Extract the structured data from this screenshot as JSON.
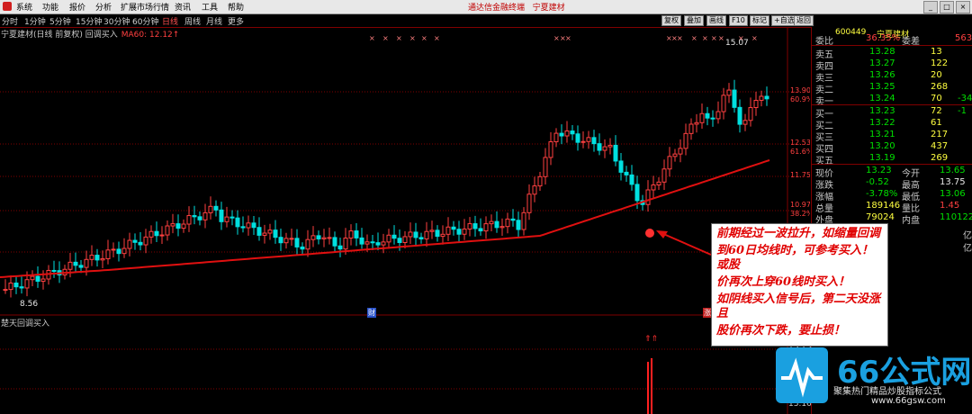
{
  "menu": {
    "items": [
      "系统",
      "功能",
      "报价",
      "分析",
      "扩展市场行情",
      "资讯",
      "工具",
      "帮助"
    ],
    "title": "通达信金融终端",
    "stock_label": "宁夏建材"
  },
  "toolbar": {
    "periods": [
      "分时",
      "1分钟",
      "5分钟",
      "15分钟",
      "30分钟",
      "60分钟",
      "日线",
      "周线",
      "月线",
      "更多"
    ],
    "active_period": "日线",
    "buttons": [
      "复权",
      "叠加",
      "画线",
      "F10",
      "标记",
      "+自选",
      "返回"
    ]
  },
  "chart": {
    "title": "宁夏建材(日线 前复权) 回调买入",
    "ma_label": "MA60: 12.12↑",
    "high_label": "15.07",
    "low_label": "8.56",
    "indicator_title": "楚天回调买入",
    "tag_cai": "财",
    "tag_zhang": "涨",
    "price_axis": [
      "13.90",
      "60.9%",
      "12.53",
      "61.6%",
      "11.75",
      "10.97",
      "38.2%"
    ],
    "lower_axis": [
      "13.75",
      "13.16"
    ]
  },
  "quote": {
    "code": "600449",
    "name": "宁夏建材",
    "weibi_label": "委比",
    "weibi": "36.35%",
    "weicha_label": "委差",
    "weicha": "563",
    "sell": [
      {
        "label": "卖五",
        "price": "13.28",
        "vol": "13"
      },
      {
        "label": "卖四",
        "price": "13.27",
        "vol": "122"
      },
      {
        "label": "卖三",
        "price": "13.26",
        "vol": "20"
      },
      {
        "label": "卖二",
        "price": "13.25",
        "vol": "268"
      },
      {
        "label": "卖一",
        "price": "13.24",
        "vol": "70",
        "chg": "-34"
      }
    ],
    "buy": [
      {
        "label": "买一",
        "price": "13.23",
        "vol": "72",
        "chg": "-1"
      },
      {
        "label": "买二",
        "price": "13.22",
        "vol": "61"
      },
      {
        "label": "买三",
        "price": "13.21",
        "vol": "217"
      },
      {
        "label": "买四",
        "price": "13.20",
        "vol": "437"
      },
      {
        "label": "买五",
        "price": "13.19",
        "vol": "269"
      }
    ],
    "stats": [
      {
        "l1": "现价",
        "v1": "13.23",
        "l2": "今开",
        "v2": "13.65"
      },
      {
        "l1": "涨跌",
        "v1": "-0.52",
        "l2": "最高",
        "v2": "13.75"
      },
      {
        "l1": "涨幅",
        "v1": "-3.78%",
        "l2": "最低",
        "v2": "13.06"
      },
      {
        "l1": "总量",
        "v1": "189146",
        "l2": "量比",
        "v2": "1.45"
      },
      {
        "l1": "外盘",
        "v1": "79024",
        "l2": "内盘",
        "v2": "110122"
      }
    ],
    "yi_label": "亿"
  },
  "annotation": {
    "lines": [
      "前期经过一波拉升，如缩量回调",
      "到60日均线时，可参考买入！或股",
      "价再次上穿60线时买入！",
      "如阴线买入信号后，第二天没涨且",
      "股价再次下跌，要止损！"
    ]
  },
  "watermark": {
    "brand": "66公式网",
    "sub": "聚集热门精品炒股指标公式",
    "url": "www.66gsw.com"
  },
  "colors": {
    "up": "#ff4040",
    "down": "#00e0e0",
    "ma": "#e01010",
    "bg": "#000000"
  }
}
